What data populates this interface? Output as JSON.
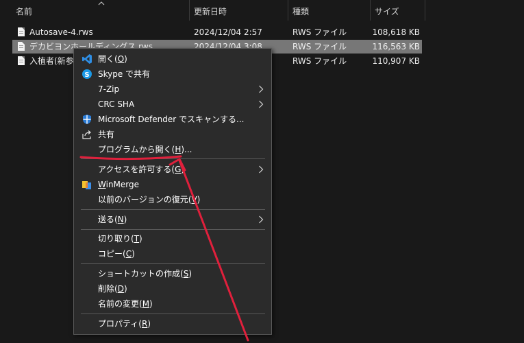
{
  "columns": {
    "name": "名前",
    "modified": "更新日時",
    "type": "種類",
    "size": "サイズ"
  },
  "files": [
    {
      "name": "Autosave-4.rws",
      "date": "2024/12/04 2:57",
      "type": "RWS ファイル",
      "size": "108,618 KB"
    },
    {
      "name": "デカビヨンホールディングス.rws",
      "date": "2024/12/04 3:08",
      "type": "RWS ファイル",
      "size": "116,563 KB"
    },
    {
      "name": "入植者(新参",
      "date": "",
      "type": "RWS ファイル",
      "size": "110,907 KB"
    }
  ],
  "menu": {
    "open": {
      "text": "開く(",
      "key": "O",
      "end": ")"
    },
    "skype": "Skype で共有",
    "zip": "7-Zip",
    "crc": "CRC SHA",
    "defender": "Microsoft Defender でスキャンする...",
    "share": "共有",
    "open_with": {
      "text": "プログラムから開く(",
      "key": "H",
      "end": ")..."
    },
    "access": {
      "text": "アクセスを許可する(",
      "key": "G",
      "end": ")"
    },
    "winmerge": {
      "key": "W",
      "text": "inMerge"
    },
    "restore": {
      "text": "以前のバージョンの復元(",
      "key": "V",
      "end": ")"
    },
    "send": {
      "text": "送る(",
      "key": "N",
      "end": ")"
    },
    "cut": {
      "text": "切り取り(",
      "key": "T",
      "end": ")"
    },
    "copy": {
      "text": "コピー(",
      "key": "C",
      "end": ")"
    },
    "shortcut": {
      "text": "ショートカットの作成(",
      "key": "S",
      "end": ")"
    },
    "delete": {
      "text": "削除(",
      "key": "D",
      "end": ")"
    },
    "rename": {
      "text": "名前の変更(",
      "key": "M",
      "end": ")"
    },
    "properties": {
      "text": "プロパティ(",
      "key": "R",
      "end": ")"
    }
  },
  "colors": {
    "background": "#191919",
    "menu_bg": "#2b2b2b",
    "selection": "#777777",
    "annotation": "#e0203c",
    "vscode_blue": "#2f8fe6",
    "skype_blue": "#1b9ae8"
  },
  "icons": [
    "vscode-icon",
    "skype-icon",
    "defender-shield-icon",
    "share-icon",
    "winmerge-icon",
    "submenu-arrow-icon",
    "file-icon"
  ]
}
